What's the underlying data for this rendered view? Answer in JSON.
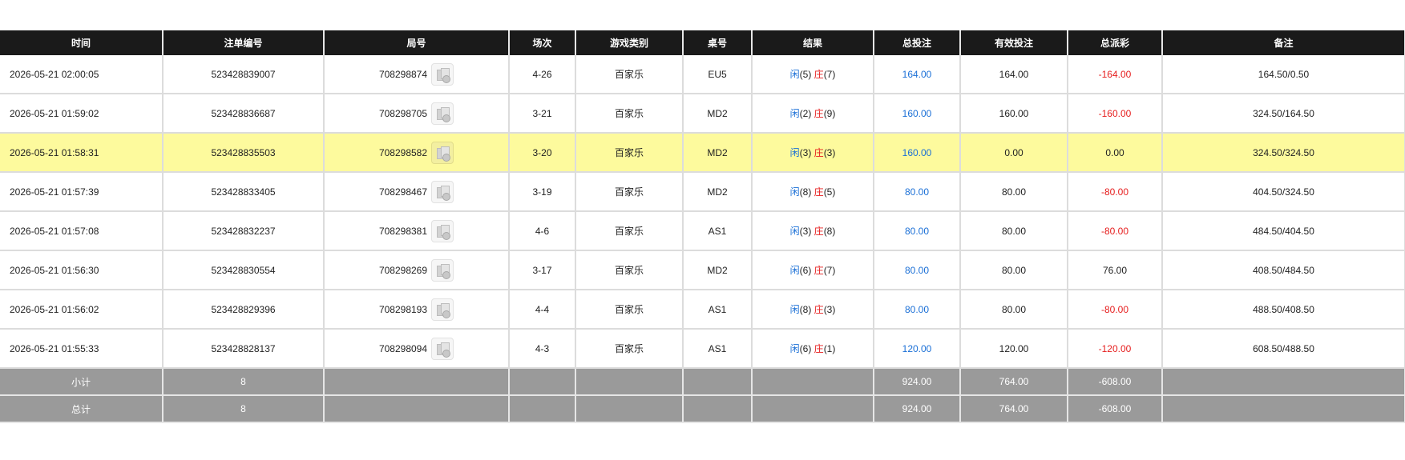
{
  "headers": [
    "时间",
    "注单编号",
    "局号",
    "场次",
    "游戏类别",
    "桌号",
    "结果",
    "总投注",
    "有效投注",
    "总派彩",
    "备注"
  ],
  "labels": {
    "player": "闲",
    "banker": "庄"
  },
  "rows": [
    {
      "time": "2026-05-21 02:00:05",
      "bet_id": "523428839007",
      "round": "708298874",
      "shoe": "4-26",
      "game": "百家乐",
      "table": "EU5",
      "player": "(5)",
      "banker": "(7)",
      "total": "164.00",
      "valid": "164.00",
      "payout": "-164.00",
      "payout_color": "red",
      "note": "164.50/0.50"
    },
    {
      "time": "2026-05-21 01:59:02",
      "bet_id": "523428836687",
      "round": "708298705",
      "shoe": "3-21",
      "game": "百家乐",
      "table": "MD2",
      "player": "(2)",
      "banker": "(9)",
      "total": "160.00",
      "valid": "160.00",
      "payout": "-160.00",
      "payout_color": "red",
      "note": "324.50/164.50"
    },
    {
      "time": "2026-05-21 01:58:31",
      "bet_id": "523428835503",
      "round": "708298582",
      "shoe": "3-20",
      "game": "百家乐",
      "table": "MD2",
      "player": "(3)",
      "banker": "(3)",
      "total": "160.00",
      "valid": "0.00",
      "payout": "0.00",
      "payout_color": "black",
      "note": "324.50/324.50",
      "highlight": true
    },
    {
      "time": "2026-05-21 01:57:39",
      "bet_id": "523428833405",
      "round": "708298467",
      "shoe": "3-19",
      "game": "百家乐",
      "table": "MD2",
      "player": "(8)",
      "banker": "(5)",
      "total": "80.00",
      "valid": "80.00",
      "payout": "-80.00",
      "payout_color": "red",
      "note": "404.50/324.50"
    },
    {
      "time": "2026-05-21 01:57:08",
      "bet_id": "523428832237",
      "round": "708298381",
      "shoe": "4-6",
      "game": "百家乐",
      "table": "AS1",
      "player": "(3)",
      "banker": "(8)",
      "total": "80.00",
      "valid": "80.00",
      "payout": "-80.00",
      "payout_color": "red",
      "note": "484.50/404.50"
    },
    {
      "time": "2026-05-21 01:56:30",
      "bet_id": "523428830554",
      "round": "708298269",
      "shoe": "3-17",
      "game": "百家乐",
      "table": "MD2",
      "player": "(6)",
      "banker": "(7)",
      "total": "80.00",
      "valid": "80.00",
      "payout": "76.00",
      "payout_color": "black",
      "note": "408.50/484.50"
    },
    {
      "time": "2026-05-21 01:56:02",
      "bet_id": "523428829396",
      "round": "708298193",
      "shoe": "4-4",
      "game": "百家乐",
      "table": "AS1",
      "player": "(8)",
      "banker": "(3)",
      "total": "80.00",
      "valid": "80.00",
      "payout": "-80.00",
      "payout_color": "red",
      "note": "488.50/408.50"
    },
    {
      "time": "2026-05-21 01:55:33",
      "bet_id": "523428828137",
      "round": "708298094",
      "shoe": "4-3",
      "game": "百家乐",
      "table": "AS1",
      "player": "(6)",
      "banker": "(1)",
      "total": "120.00",
      "valid": "120.00",
      "payout": "-120.00",
      "payout_color": "red",
      "note": "608.50/488.50"
    }
  ],
  "subtotal": {
    "label": "小计",
    "count": "8",
    "total": "924.00",
    "valid": "764.00",
    "payout": "-608.00"
  },
  "grandtotal": {
    "label": "总计",
    "count": "8",
    "total": "924.00",
    "valid": "764.00",
    "payout": "-608.00"
  },
  "icons": {
    "replay": "replay-video-icon"
  },
  "colors": {
    "header_bg": "#1a1a1a",
    "highlight_bg": "#fdfa9d",
    "summary_bg": "#9a9a9a",
    "blue": "#1a6fd6",
    "red": "#e61e1e"
  }
}
